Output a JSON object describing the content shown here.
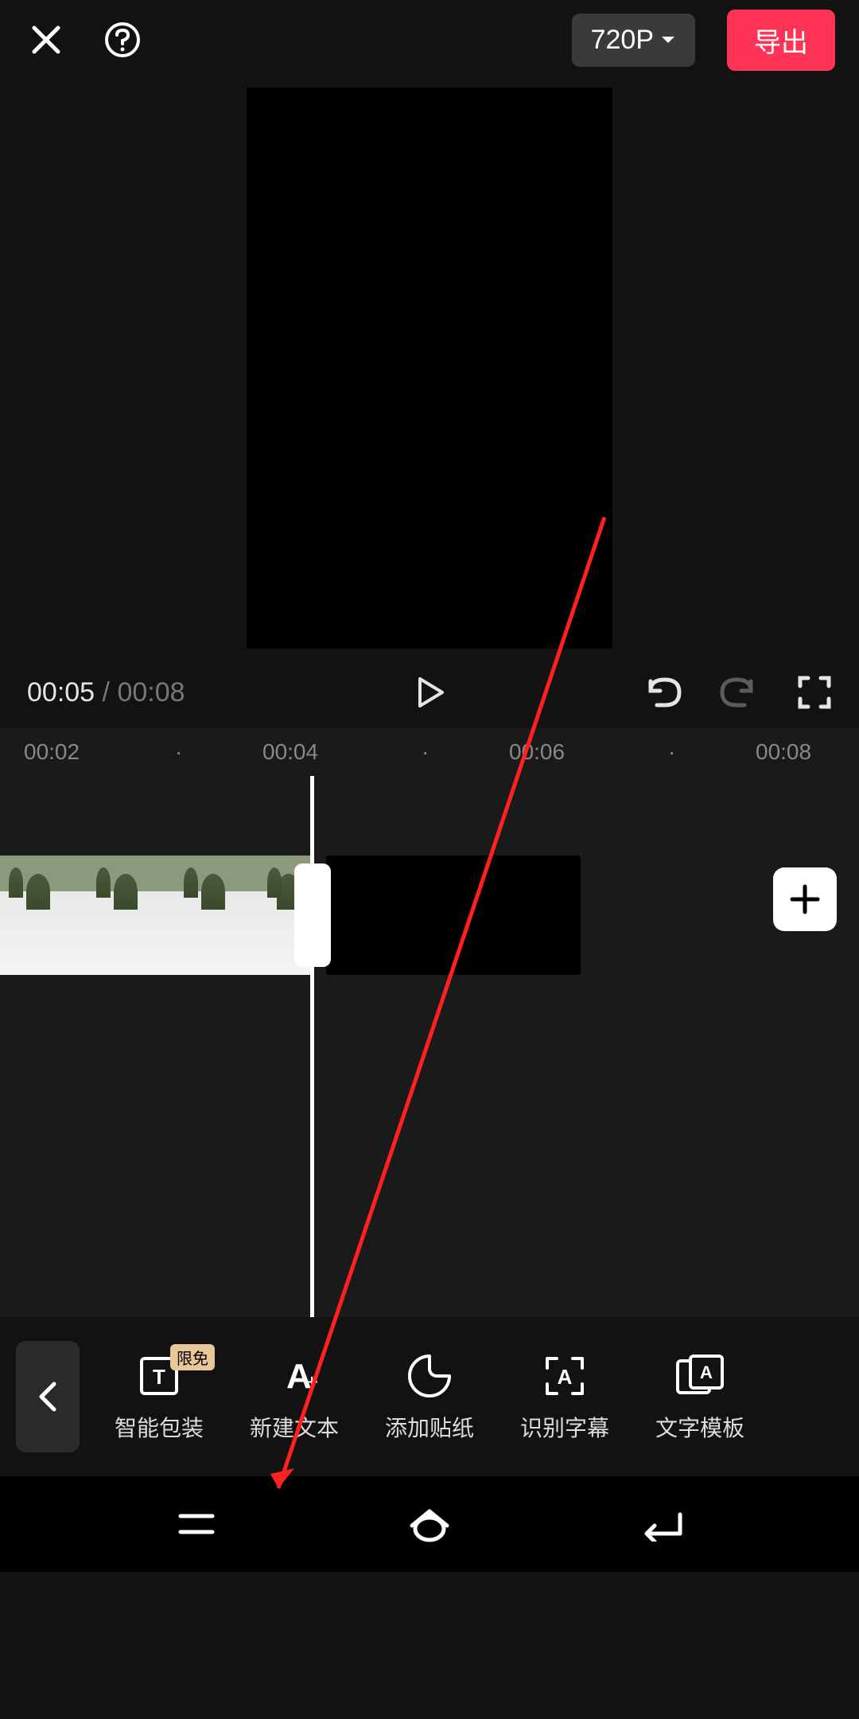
{
  "header": {
    "resolution": "720P",
    "export": "导出"
  },
  "playback": {
    "current": "00:05",
    "total": "00:08"
  },
  "ruler": [
    "00:02",
    "·",
    "00:04",
    "·",
    "00:06",
    "·",
    "00:08"
  ],
  "toolbar": {
    "badge": "限免",
    "items": [
      {
        "label": "智能包装"
      },
      {
        "label": "新建文本"
      },
      {
        "label": "添加贴纸"
      },
      {
        "label": "识别字幕"
      },
      {
        "label": "文字模板"
      }
    ]
  }
}
